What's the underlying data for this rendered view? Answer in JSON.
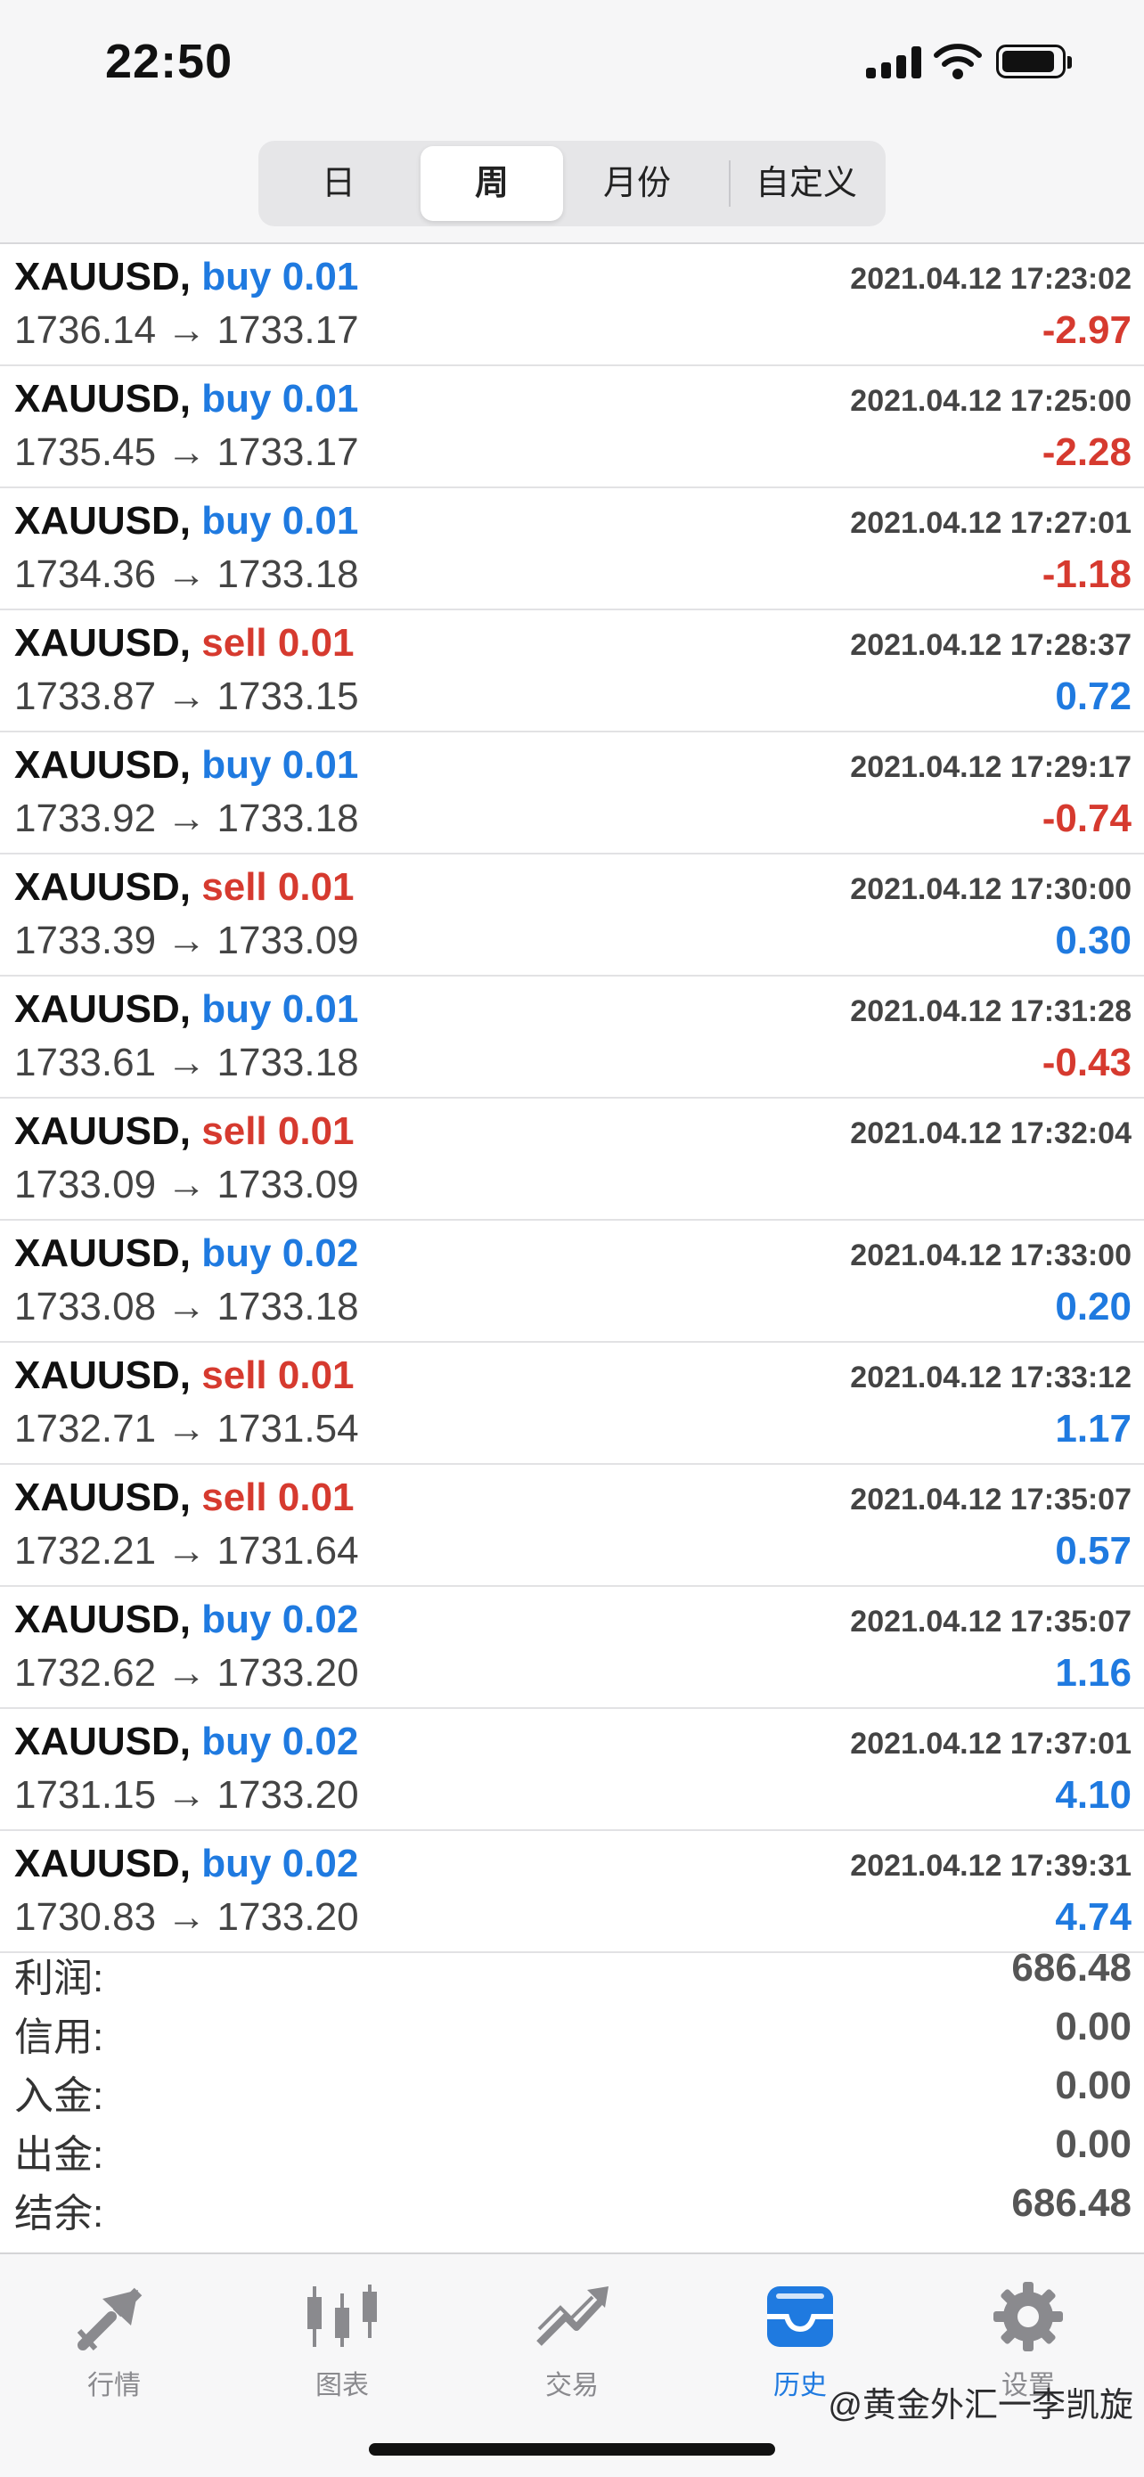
{
  "status_bar": {
    "time": "22:50"
  },
  "segments": [
    {
      "label": "日",
      "active": false
    },
    {
      "label": "周",
      "active": true
    },
    {
      "label": "月份",
      "active": false
    },
    {
      "label": "自定义",
      "active": false
    }
  ],
  "trades": [
    {
      "symbol": "XAUUSD,",
      "side": "buy 0.01",
      "prices": "1736.14 → 1733.17",
      "time": "2021.04.12 17:23:02",
      "profit": "-2.97"
    },
    {
      "symbol": "XAUUSD,",
      "side": "buy 0.01",
      "prices": "1735.45 → 1733.17",
      "time": "2021.04.12 17:25:00",
      "profit": "-2.28"
    },
    {
      "symbol": "XAUUSD,",
      "side": "buy 0.01",
      "prices": "1734.36 → 1733.18",
      "time": "2021.04.12 17:27:01",
      "profit": "-1.18"
    },
    {
      "symbol": "XAUUSD,",
      "side": "sell 0.01",
      "prices": "1733.87 → 1733.15",
      "time": "2021.04.12 17:28:37",
      "profit": "0.72"
    },
    {
      "symbol": "XAUUSD,",
      "side": "buy 0.01",
      "prices": "1733.92 → 1733.18",
      "time": "2021.04.12 17:29:17",
      "profit": "-0.74"
    },
    {
      "symbol": "XAUUSD,",
      "side": "sell 0.01",
      "prices": "1733.39 → 1733.09",
      "time": "2021.04.12 17:30:00",
      "profit": "0.30"
    },
    {
      "symbol": "XAUUSD,",
      "side": "buy 0.01",
      "prices": "1733.61 → 1733.18",
      "time": "2021.04.12 17:31:28",
      "profit": "-0.43"
    },
    {
      "symbol": "XAUUSD,",
      "side": "sell 0.01",
      "prices": "1733.09 → 1733.09",
      "time": "2021.04.12 17:32:04",
      "profit": ""
    },
    {
      "symbol": "XAUUSD,",
      "side": "buy 0.02",
      "prices": "1733.08 → 1733.18",
      "time": "2021.04.12 17:33:00",
      "profit": "0.20"
    },
    {
      "symbol": "XAUUSD,",
      "side": "sell 0.01",
      "prices": "1732.71 → 1731.54",
      "time": "2021.04.12 17:33:12",
      "profit": "1.17"
    },
    {
      "symbol": "XAUUSD,",
      "side": "sell 0.01",
      "prices": "1732.21 → 1731.64",
      "time": "2021.04.12 17:35:07",
      "profit": "0.57"
    },
    {
      "symbol": "XAUUSD,",
      "side": "buy 0.02",
      "prices": "1732.62 → 1733.20",
      "time": "2021.04.12 17:35:07",
      "profit": "1.16"
    },
    {
      "symbol": "XAUUSD,",
      "side": "buy 0.02",
      "prices": "1731.15 → 1733.20",
      "time": "2021.04.12 17:37:01",
      "profit": "4.10"
    },
    {
      "symbol": "XAUUSD,",
      "side": "buy 0.02",
      "prices": "1730.83 → 1733.20",
      "time": "2021.04.12 17:39:31",
      "profit": "4.74"
    }
  ],
  "summary": [
    {
      "label": "利润:",
      "value": "686.48"
    },
    {
      "label": "信用:",
      "value": "0.00"
    },
    {
      "label": "入金:",
      "value": "0.00"
    },
    {
      "label": "出金:",
      "value": "0.00"
    },
    {
      "label": "结余:",
      "value": "686.48"
    }
  ],
  "tabs": [
    {
      "label": "行情",
      "icon": "quotes-arrows-icon",
      "active": false
    },
    {
      "label": "图表",
      "icon": "candlestick-chart-icon",
      "active": false
    },
    {
      "label": "交易",
      "icon": "trade-trend-icon",
      "active": false
    },
    {
      "label": "历史",
      "icon": "history-inbox-icon",
      "active": true
    },
    {
      "label": "设置",
      "icon": "gear-icon",
      "active": false
    }
  ],
  "watermark": "@黄金外汇一李凯旋",
  "colors": {
    "buy": "#1f7ae0",
    "sell": "#d63a2f",
    "active_tab": "#1f7ae0",
    "inactive_tab": "#8a8a8e"
  }
}
